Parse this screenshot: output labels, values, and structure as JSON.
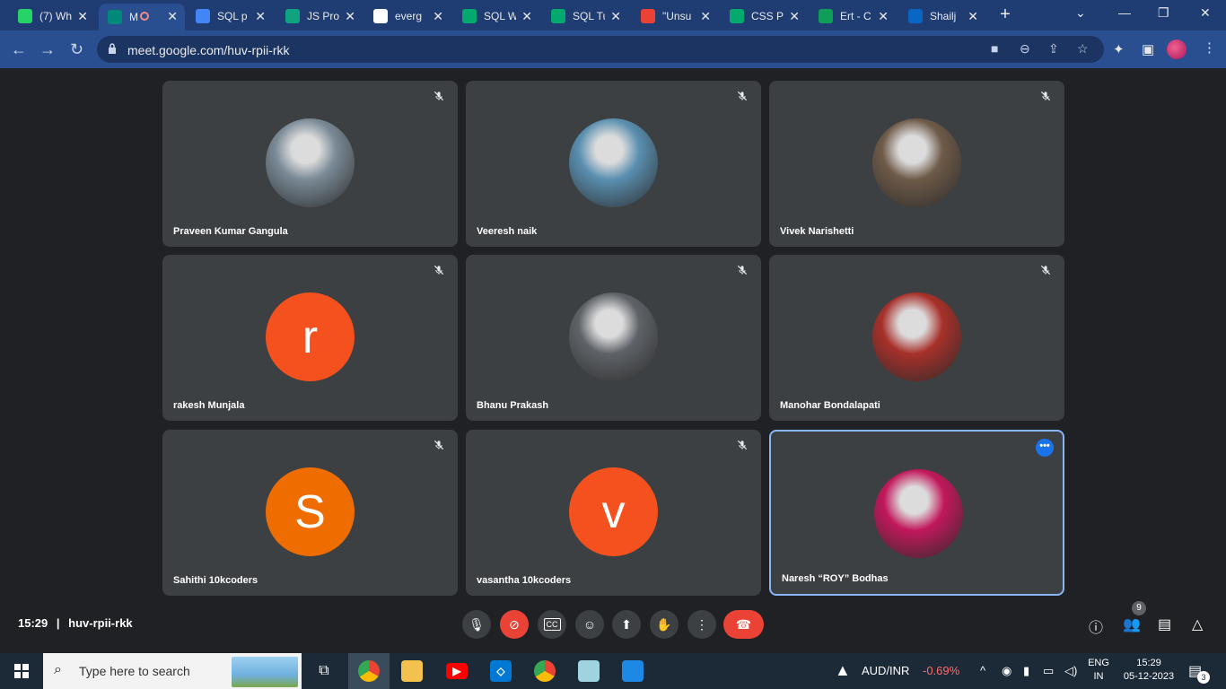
{
  "browser": {
    "tabs": [
      {
        "title": "(7) Wh",
        "icon": "whatsapp-icon",
        "color": "#25d366"
      },
      {
        "title": "M",
        "icon": "google-meet-icon",
        "color": "#00897b",
        "active": true
      },
      {
        "title": "SQL p",
        "icon": "google-docs-icon",
        "color": "#4285f4"
      },
      {
        "title": "JS Pro",
        "icon": "chatgpt-icon",
        "color": "#10a37f"
      },
      {
        "title": "everg",
        "icon": "google-icon",
        "color": "#ffffff"
      },
      {
        "title": "SQL W",
        "icon": "w3schools-icon",
        "color": "#04aa6d"
      },
      {
        "title": "SQL Tu",
        "icon": "w3schools-icon",
        "color": "#04aa6d"
      },
      {
        "title": "\"Unsu",
        "icon": "gmail-icon",
        "color": "#ea4335"
      },
      {
        "title": "CSS P",
        "icon": "w3schools-icon",
        "color": "#04aa6d"
      },
      {
        "title": "Ert - C",
        "icon": "google-sheets-icon",
        "color": "#0f9d58"
      },
      {
        "title": "Shailj",
        "icon": "linkedin-icon",
        "color": "#0a66c2"
      }
    ],
    "new_tab": "+",
    "url": "meet.google.com/huv-rpii-rkk"
  },
  "participants": [
    {
      "name": "Praveen Kumar Gangula",
      "initial": "",
      "bg": "#7a8a96"
    },
    {
      "name": "Veeresh naik",
      "initial": "",
      "bg": "#5a8fb0"
    },
    {
      "name": "Vivek Narishetti",
      "initial": "",
      "bg": "#6e5a48"
    },
    {
      "name": "rakesh Munjala",
      "initial": "r",
      "bg": "#f4511e"
    },
    {
      "name": "Bhanu Prakash",
      "initial": "",
      "bg": "#5f6368"
    },
    {
      "name": "Manohar Bondalapati",
      "initial": "",
      "bg": "#a8302a"
    },
    {
      "name": "Sahithi 10kcoders",
      "initial": "S",
      "bg": "#ef6c00"
    },
    {
      "name": "vasantha 10kcoders",
      "initial": "v",
      "bg": "#f4511e"
    },
    {
      "name": "Naresh “ROY” Bodhas",
      "initial": "",
      "bg": "#c2185b"
    }
  ],
  "meeting": {
    "time": "15:29",
    "separator": "|",
    "code": "huv-rpii-rkk",
    "people_count": "9"
  },
  "taskbar": {
    "search_placeholder": "Type here to search",
    "ticker": "AUD/INR",
    "ticker_change": "-0.69%",
    "lang_top": "ENG",
    "lang_bottom": "IN",
    "clock_time": "15:29",
    "clock_date": "05-12-2023",
    "notifications": "3"
  }
}
